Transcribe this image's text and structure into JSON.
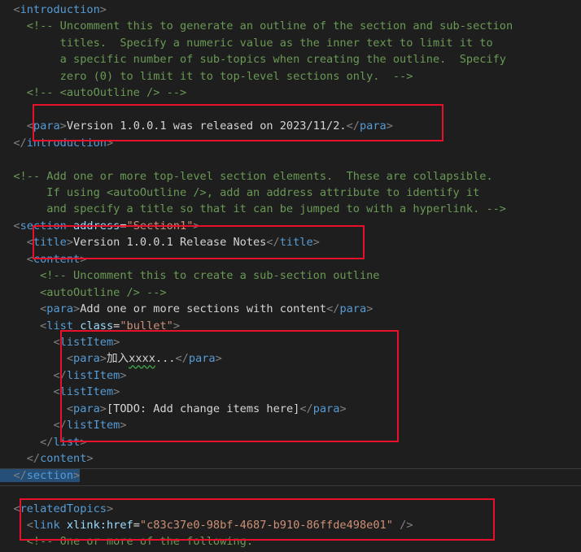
{
  "editor": {
    "lines": [
      [
        {
          "c": "t-br",
          "t": "  <"
        },
        {
          "c": "t-tag",
          "t": "introduction"
        },
        {
          "c": "t-br",
          "t": ">"
        }
      ],
      [
        {
          "c": "t-com",
          "t": "    <!-- Uncomment this to generate an outline of the section and sub-section"
        }
      ],
      [
        {
          "c": "t-com",
          "t": "         titles.  Specify a numeric value as the inner text to limit it to"
        }
      ],
      [
        {
          "c": "t-com",
          "t": "         a specific number of sub-topics when creating the outline.  Specify"
        }
      ],
      [
        {
          "c": "t-com",
          "t": "         zero (0) to limit it to top-level sections only.  -->"
        }
      ],
      [
        {
          "c": "t-com",
          "t": "    <!-- <autoOutline /> -->"
        }
      ],
      [],
      [
        {
          "c": "t-br",
          "t": "    <"
        },
        {
          "c": "t-tag",
          "t": "para"
        },
        {
          "c": "t-br",
          "t": ">"
        },
        {
          "c": "t-txt",
          "t": "Version 1.0.0.1 was released on 2023/11/2."
        },
        {
          "c": "t-br",
          "t": "</"
        },
        {
          "c": "t-tag",
          "t": "para"
        },
        {
          "c": "t-br",
          "t": ">"
        }
      ],
      [
        {
          "c": "t-br",
          "t": "  </"
        },
        {
          "c": "t-tag",
          "t": "introduction"
        },
        {
          "c": "t-br",
          "t": ">"
        }
      ],
      [],
      [
        {
          "c": "t-com",
          "t": "  <!-- Add one or more top-level section elements.  These are collapsible."
        }
      ],
      [
        {
          "c": "t-com",
          "t": "       If using <autoOutline />, add an address attribute to identify it"
        }
      ],
      [
        {
          "c": "t-com",
          "t": "       and specify a title so that it can be jumped to with a hyperlink. -->"
        }
      ],
      [
        {
          "c": "t-br",
          "t": "  <"
        },
        {
          "c": "t-tag",
          "t": "section"
        },
        {
          "c": "t-txt",
          "t": " "
        },
        {
          "c": "t-attr",
          "t": "address"
        },
        {
          "c": "t-txt",
          "t": "="
        },
        {
          "c": "t-str",
          "t": "\"Section1\""
        },
        {
          "c": "t-br",
          "t": ">"
        }
      ],
      [
        {
          "c": "t-br",
          "t": "    <"
        },
        {
          "c": "t-tag",
          "t": "title"
        },
        {
          "c": "t-br",
          "t": ">"
        },
        {
          "c": "t-txt",
          "t": "Version 1.0.0.1 Release Notes"
        },
        {
          "c": "t-br",
          "t": "</"
        },
        {
          "c": "t-tag",
          "t": "title"
        },
        {
          "c": "t-br",
          "t": ">"
        }
      ],
      [
        {
          "c": "t-br",
          "t": "    <"
        },
        {
          "c": "t-tag",
          "t": "content"
        },
        {
          "c": "t-br",
          "t": ">"
        }
      ],
      [
        {
          "c": "t-com",
          "t": "      <!-- Uncomment this to create a sub-section outline"
        }
      ],
      [
        {
          "c": "t-com",
          "t": "      <autoOutline /> -->"
        }
      ],
      [
        {
          "c": "t-br",
          "t": "      <"
        },
        {
          "c": "t-tag",
          "t": "para"
        },
        {
          "c": "t-br",
          "t": ">"
        },
        {
          "c": "t-txt",
          "t": "Add one or more sections with content"
        },
        {
          "c": "t-br",
          "t": "</"
        },
        {
          "c": "t-tag",
          "t": "para"
        },
        {
          "c": "t-br",
          "t": ">"
        }
      ],
      [
        {
          "c": "t-br",
          "t": "      <"
        },
        {
          "c": "t-tag",
          "t": "list"
        },
        {
          "c": "t-txt",
          "t": " "
        },
        {
          "c": "t-attr",
          "t": "class"
        },
        {
          "c": "t-txt",
          "t": "="
        },
        {
          "c": "t-str",
          "t": "\"bullet\""
        },
        {
          "c": "t-br",
          "t": ">"
        }
      ],
      [
        {
          "c": "t-br",
          "t": "        <"
        },
        {
          "c": "t-tag",
          "t": "listItem"
        },
        {
          "c": "t-br",
          "t": ">"
        }
      ],
      [
        {
          "c": "t-br",
          "t": "          <"
        },
        {
          "c": "t-tag",
          "t": "para"
        },
        {
          "c": "t-br",
          "t": ">"
        },
        {
          "c": "t-txt",
          "t": "加入"
        },
        {
          "c": "t-txt squiggle",
          "t": "xxxx"
        },
        {
          "c": "t-txt",
          "t": "..."
        },
        {
          "c": "t-br",
          "t": "</"
        },
        {
          "c": "t-tag",
          "t": "para"
        },
        {
          "c": "t-br",
          "t": ">"
        }
      ],
      [
        {
          "c": "t-br",
          "t": "        </"
        },
        {
          "c": "t-tag",
          "t": "listItem"
        },
        {
          "c": "t-br",
          "t": ">"
        }
      ],
      [
        {
          "c": "t-br",
          "t": "        <"
        },
        {
          "c": "t-tag",
          "t": "listItem"
        },
        {
          "c": "t-br",
          "t": ">"
        }
      ],
      [
        {
          "c": "t-br",
          "t": "          <"
        },
        {
          "c": "t-tag",
          "t": "para"
        },
        {
          "c": "t-br",
          "t": ">"
        },
        {
          "c": "t-txt",
          "t": "[TODO: Add change items here]"
        },
        {
          "c": "t-br",
          "t": "</"
        },
        {
          "c": "t-tag",
          "t": "para"
        },
        {
          "c": "t-br",
          "t": ">"
        }
      ],
      [
        {
          "c": "t-br",
          "t": "        </"
        },
        {
          "c": "t-tag",
          "t": "listItem"
        },
        {
          "c": "t-br",
          "t": ">"
        }
      ],
      [
        {
          "c": "t-br",
          "t": "      </"
        },
        {
          "c": "t-tag",
          "t": "list"
        },
        {
          "c": "t-br",
          "t": ">"
        }
      ],
      [
        {
          "c": "t-br",
          "t": "    </"
        },
        {
          "c": "t-tag",
          "t": "content"
        },
        {
          "c": "t-br",
          "t": ">"
        }
      ],
      [
        {
          "c": "t-br t-sel",
          "t": "  </"
        },
        {
          "c": "t-tag t-sel",
          "t": "section"
        },
        {
          "c": "t-br t-sel",
          "t": ">"
        }
      ],
      [],
      [
        {
          "c": "t-br",
          "t": "  <"
        },
        {
          "c": "t-tag",
          "t": "relatedTopics"
        },
        {
          "c": "t-br",
          "t": ">"
        }
      ],
      [
        {
          "c": "t-br",
          "t": "    <"
        },
        {
          "c": "t-tag",
          "t": "link"
        },
        {
          "c": "t-txt",
          "t": " "
        },
        {
          "c": "t-attr",
          "t": "xlink:href"
        },
        {
          "c": "t-txt",
          "t": "="
        },
        {
          "c": "t-str",
          "t": "\"c83c37e0-98bf-4687-b910-86ffde498e01\""
        },
        {
          "c": "t-txt",
          "t": " "
        },
        {
          "c": "t-br",
          "t": "/>"
        }
      ],
      [
        {
          "c": "t-com",
          "t": "    <!-- One or more of the following:"
        }
      ]
    ]
  },
  "colors": {
    "background": "#1e1e1e",
    "tag": "#569cd6",
    "bracket": "#808080",
    "comment": "#6a9955",
    "attribute": "#9cdcfe",
    "string": "#ce9178",
    "text": "#d4d4d4",
    "highlight_box": "#e8102b",
    "selection": "#264f78"
  }
}
